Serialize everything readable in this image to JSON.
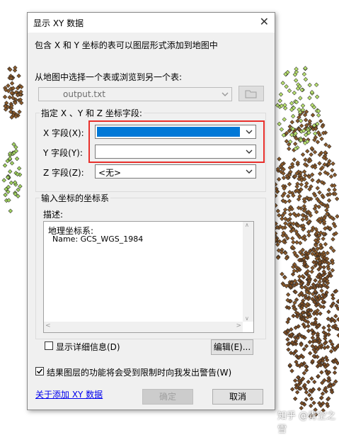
{
  "dialog": {
    "title": "显示 XY 数据",
    "description": "包含 X 和 Y 坐标的表可以图层形式添加到地图中",
    "choose_table_label": "从地图中选择一个表或浏览到另一个表:",
    "table_value": "output.txt",
    "fields_group_label": "指定 X 、Y 和 Z 坐标字段:",
    "x_field_label": "X 字段(X):",
    "x_field_value": "",
    "y_field_label": "Y 字段(Y):",
    "y_field_value": "",
    "z_field_label": "Z 字段(Z):",
    "z_field_value": "<无>",
    "crs_group_label": "输入坐标的坐标系",
    "crs_desc_label": "描述:",
    "crs_text_line1": "地理坐标系:",
    "crs_text_line2": "Name: GCS_WGS_1984",
    "show_details_label": "显示详细信息(D)",
    "show_details_checked": false,
    "edit_button": "编辑(E)...",
    "warn_label": "结果图层的功能将会受到限制时向我发出警告(W)",
    "warn_checked": true,
    "about_link": "关于添加 XY 数据",
    "ok_button": "确定",
    "cancel_button": "取消"
  },
  "colors": {
    "highlight_box": "#e8302c",
    "selection": "#0078d7"
  },
  "watermark": "知乎 @青空之雪"
}
